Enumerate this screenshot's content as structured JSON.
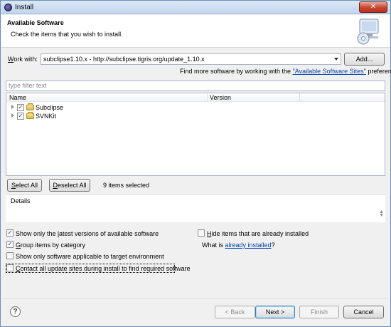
{
  "window": {
    "title": "Install",
    "close_glyph": "✕"
  },
  "header": {
    "title": "Available Software",
    "description": "Check the items that you wish to install."
  },
  "work_with": {
    "label_prefix": "W",
    "label_rest": "ork with:",
    "value": "subclipse1.10.x - http://subclipse.tigris.org/update_1.10.x",
    "add_button": "Add...",
    "more_text": "Find more software by working with the ",
    "more_link": "\"Available Software Sites\"",
    "more_suffix": " preferences."
  },
  "filter": {
    "placeholder": "type filter text"
  },
  "tree": {
    "columns": {
      "name": "Name",
      "version": "Version"
    },
    "rows": [
      {
        "label": "Subclipse",
        "checked": true,
        "check_glyph": "✓"
      },
      {
        "label": "SVNKit",
        "checked": true,
        "check_glyph": "✓"
      }
    ]
  },
  "selection": {
    "select_all_prefix": "S",
    "select_all_rest": "elect All",
    "deselect_all_prefix": "D",
    "deselect_all_rest": "eselect All",
    "count_text": "9 items selected"
  },
  "details": {
    "label": "Details",
    "scroll_up": "▲",
    "scroll_down": "▼"
  },
  "options": {
    "latest": {
      "pre": "Show only the ",
      "u": "l",
      "post": "atest versions of available software",
      "checked": true
    },
    "group": {
      "pre": "",
      "u": "G",
      "post": "roup items by category",
      "checked": true
    },
    "applicable": {
      "pre": "Show only software applicable to target environment",
      "u": "",
      "post": "",
      "checked": false
    },
    "contact": {
      "pre": "",
      "u": "C",
      "post": "ontact all update sites during install to find required software",
      "checked": false
    },
    "hide": {
      "pre": "",
      "u": "H",
      "post": "ide items that are already installed",
      "checked": false
    },
    "what_is_text": "What is ",
    "already_installed_link": "already installed",
    "what_is_suffix": "?"
  },
  "footer": {
    "help_glyph": "?",
    "back": "< Back",
    "next": "Next >",
    "finish": "Finish",
    "cancel": "Cancel"
  },
  "colors": {
    "link": "#0645ad",
    "title_gradient_top": "#dbe8f6",
    "close_red": "#c7432f"
  }
}
